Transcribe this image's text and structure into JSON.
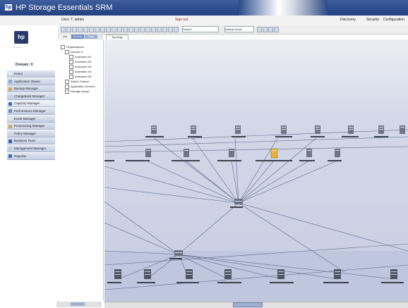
{
  "window": {
    "title": "HP Storage Essentials SRM"
  },
  "header": {
    "user_label": "User: T. admin",
    "signout_label": "Sign out",
    "links": [
      "Discovery",
      "Security",
      "Configuration"
    ]
  },
  "toolbar": {
    "search_placeholder": "Search",
    "view_select": "Default Zoom"
  },
  "sidebar": {
    "logo_text": "hp",
    "tagline": "invent",
    "nav_title": "Domain: X",
    "items": [
      {
        "label": "Home",
        "icon": "home-icon",
        "color": "#e8e8e8"
      },
      {
        "label": "Application Viewer",
        "icon": "app-viewer-icon",
        "color": "#8aa7d8"
      },
      {
        "label": "Backup Manager",
        "icon": "backup-icon",
        "color": "#d9a441"
      },
      {
        "label": "Chargeback Manager",
        "icon": "chargeback-icon",
        "color": "#c8d3e6"
      },
      {
        "label": "Capacity Manager",
        "icon": "capacity-icon",
        "color": "#3a6ab8"
      },
      {
        "label": "Performance Manager",
        "icon": "performance-icon",
        "color": "#6e8bbd"
      },
      {
        "label": "Event Manager",
        "icon": "event-icon",
        "color": "#e6e6e6"
      },
      {
        "label": "Provisioning Manager",
        "icon": "provisioning-icon",
        "color": "#c9ae5a"
      },
      {
        "label": "Policy Manager",
        "icon": "policy-icon",
        "color": "#d8d8d8"
      },
      {
        "label": "Business Tools",
        "icon": "business-tools-icon",
        "color": "#3b5fa3"
      },
      {
        "label": "Management Manager",
        "icon": "management-icon",
        "color": "#bfcbe0"
      },
      {
        "label": "Reporter",
        "icon": "reporter-icon",
        "color": "#4669a9"
      }
    ]
  },
  "tree": {
    "tabs": [
      "List",
      "Access",
      "Topo"
    ],
    "nodes": [
      {
        "label": "Organizations",
        "level": 0
      },
      {
        "label": "Domain X",
        "level": 1
      },
      {
        "label": "hostname-01",
        "level": 2
      },
      {
        "label": "hostname-02",
        "level": 2
      },
      {
        "label": "hostname-03",
        "level": 2
      },
      {
        "label": "hostname-04",
        "level": 2
      },
      {
        "label": "hostname-05",
        "level": 2
      },
      {
        "label": "Switch Fabrics",
        "level": 1
      },
      {
        "label": "Application Servers",
        "level": 1
      },
      {
        "label": "Storage Arrays",
        "level": 1
      }
    ]
  },
  "canvas": {
    "tab_label": "Topology"
  }
}
